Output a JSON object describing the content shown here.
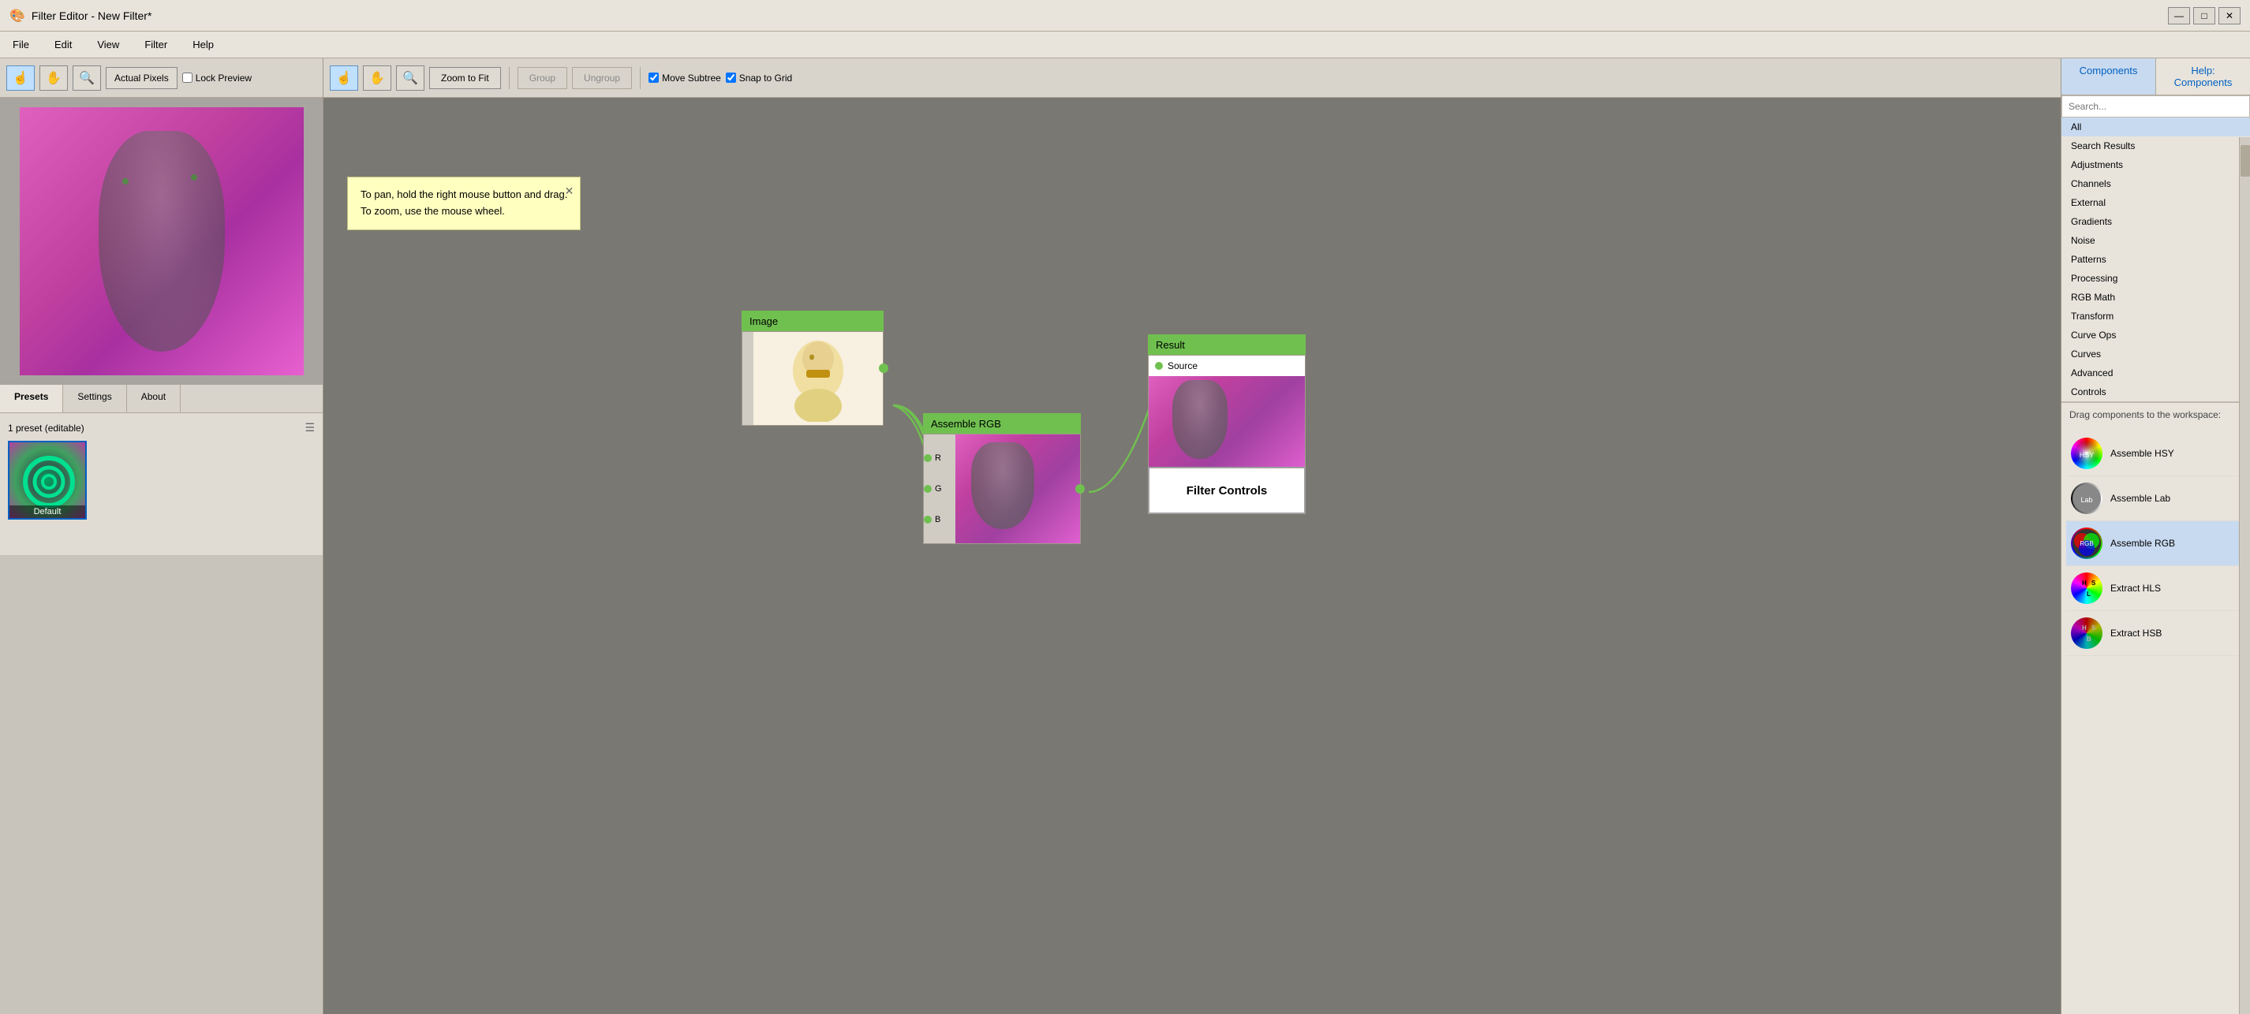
{
  "titleBar": {
    "title": "Filter Editor - New Filter*",
    "minimizeLabel": "—",
    "maximizeLabel": "□",
    "closeLabel": "✕"
  },
  "menuBar": {
    "items": [
      "File",
      "Edit",
      "View",
      "Filter",
      "Help"
    ]
  },
  "previewToolbar": {
    "actualPixelsLabel": "Actual Pixels",
    "lockPreviewLabel": "Lock Preview",
    "tools": [
      "☝",
      "✋",
      "🔍"
    ]
  },
  "tabs": {
    "items": [
      "Presets",
      "Settings",
      "About"
    ]
  },
  "presets": {
    "count": "1 preset (editable)",
    "items": [
      {
        "name": "Default"
      }
    ]
  },
  "canvasToolbar": {
    "zoomFitLabel": "Zoom to Fit",
    "groupLabel": "Group",
    "ungroupLabel": "Ungroup",
    "moveSubtreeLabel": "Move Subtree",
    "snapToGridLabel": "Snap to Grid"
  },
  "tooltip": {
    "line1": "To pan, hold the right mouse button and drag.",
    "line2": "To zoom, use the mouse wheel.",
    "closeLabel": "✕"
  },
  "nodes": {
    "image": {
      "title": "Image"
    },
    "assembleRGB": {
      "title": "Assemble RGB",
      "inputs": [
        "R",
        "G",
        "B"
      ]
    },
    "result": {
      "title": "Result",
      "sourceLabel": "Source"
    },
    "filterControls": {
      "label": "Filter Controls"
    }
  },
  "rightPanel": {
    "tabs": {
      "components": "Components",
      "help": "Help: Components"
    },
    "searchPlaceholder": "Search...",
    "categories": [
      {
        "id": "all",
        "label": "All",
        "selected": true
      },
      {
        "id": "search-results",
        "label": "Search Results"
      },
      {
        "id": "adjustments",
        "label": "Adjustments"
      },
      {
        "id": "channels",
        "label": "Channels"
      },
      {
        "id": "external",
        "label": "External"
      },
      {
        "id": "gradients",
        "label": "Gradients"
      },
      {
        "id": "noise",
        "label": "Noise"
      },
      {
        "id": "patterns",
        "label": "Patterns"
      },
      {
        "id": "processing",
        "label": "Processing"
      },
      {
        "id": "rgb-math",
        "label": "RGB Math"
      },
      {
        "id": "transform",
        "label": "Transform"
      },
      {
        "id": "curve-ops",
        "label": "Curve Ops"
      },
      {
        "id": "curves",
        "label": "Curves"
      },
      {
        "id": "advanced",
        "label": "Advanced"
      },
      {
        "id": "controls",
        "label": "Controls"
      }
    ],
    "dragLabel": "Drag components to the workspace:",
    "components": [
      {
        "id": "assemble-hsy",
        "label": "Assemble HSY",
        "iconType": "hsy"
      },
      {
        "id": "assemble-lab",
        "label": "Assemble Lab",
        "iconType": "lab"
      },
      {
        "id": "assemble-rgb",
        "label": "Assemble RGB",
        "iconType": "rgb",
        "selected": true
      },
      {
        "id": "extract-hls",
        "label": "Extract HLS",
        "iconType": "hls"
      },
      {
        "id": "extract-hsb",
        "label": "Extract HSB",
        "iconType": "hsb"
      }
    ]
  }
}
